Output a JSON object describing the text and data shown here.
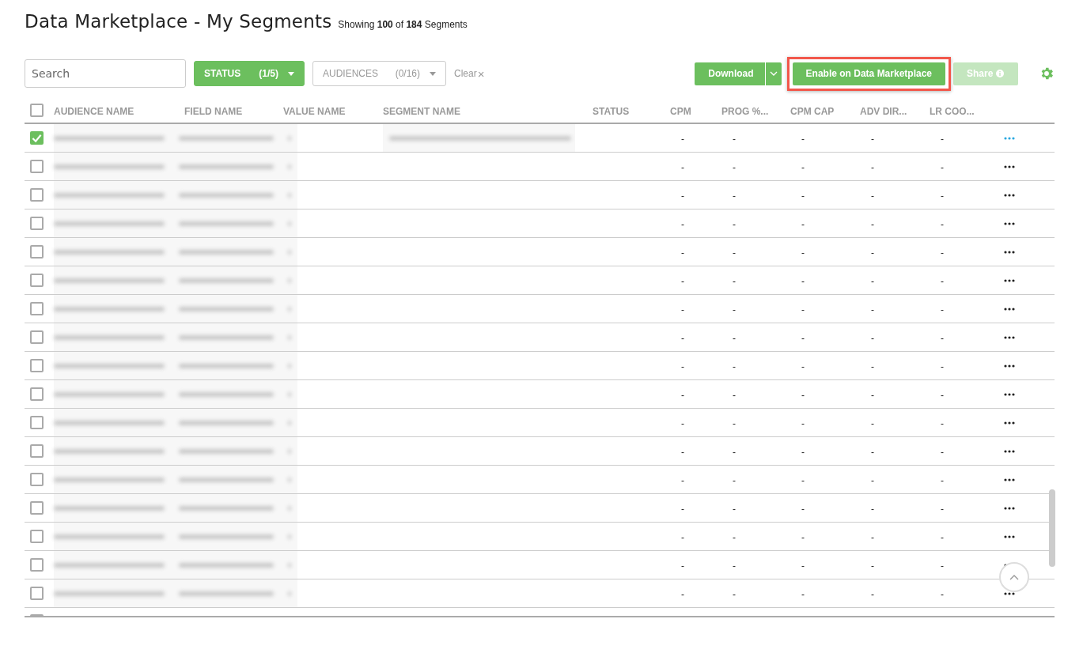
{
  "header": {
    "title": "Data Marketplace - My Segments",
    "summary": "Showing **100** of **184** Segments"
  },
  "toolbar": {
    "search": {
      "placeholder": "Search"
    },
    "filters": [
      {
        "label": "STATUS",
        "count": "(1/5)",
        "active": true
      },
      {
        "label": "AUDIENCES",
        "count": "(0/16)",
        "active": false
      }
    ],
    "clear": "Clear",
    "clear_icon": "×",
    "buttons": [
      {
        "kind": "split",
        "label": "Download",
        "disabled": false,
        "highlighted": false
      },
      {
        "kind": "plain",
        "label": "Enable on Data Marketplace",
        "disabled": false,
        "highlighted": true
      },
      {
        "kind": "info",
        "label": "Share",
        "disabled": true,
        "highlighted": false
      }
    ]
  },
  "table": {
    "all_checked": false,
    "columns": [
      "AUDIENCE NAME",
      "FIELD NAME",
      "VALUE NAME",
      "SEGMENT NAME",
      "STATUS",
      "CPM",
      "PROG %...",
      "CPM CAP",
      "ADV DIR...",
      "LR COO..."
    ],
    "rows": [
      {
        "checked": true,
        "cells": [
          "-",
          "-",
          "-",
          "-",
          "-"
        ]
      },
      {
        "checked": false,
        "cells": [
          "-",
          "-",
          "-",
          "-",
          "-"
        ]
      },
      {
        "checked": false,
        "cells": [
          "-",
          "-",
          "-",
          "-",
          "-"
        ]
      },
      {
        "checked": false,
        "cells": [
          "-",
          "-",
          "-",
          "-",
          "-"
        ]
      },
      {
        "checked": false,
        "cells": [
          "-",
          "-",
          "-",
          "-",
          "-"
        ]
      },
      {
        "checked": false,
        "cells": [
          "-",
          "-",
          "-",
          "-",
          "-"
        ]
      },
      {
        "checked": false,
        "cells": [
          "-",
          "-",
          "-",
          "-",
          "-"
        ]
      },
      {
        "checked": false,
        "cells": [
          "-",
          "-",
          "-",
          "-",
          "-"
        ]
      },
      {
        "checked": false,
        "cells": [
          "-",
          "-",
          "-",
          "-",
          "-"
        ]
      },
      {
        "checked": false,
        "cells": [
          "-",
          "-",
          "-",
          "-",
          "-"
        ]
      },
      {
        "checked": false,
        "cells": [
          "-",
          "-",
          "-",
          "-",
          "-"
        ]
      },
      {
        "checked": false,
        "cells": [
          "-",
          "-",
          "-",
          "-",
          "-"
        ]
      },
      {
        "checked": false,
        "cells": [
          "-",
          "-",
          "-",
          "-",
          "-"
        ]
      },
      {
        "checked": false,
        "cells": [
          "-",
          "-",
          "-",
          "-",
          "-"
        ]
      },
      {
        "checked": false,
        "cells": [
          "-",
          "-",
          "-",
          "-",
          "-"
        ]
      },
      {
        "checked": false,
        "cells": [
          "-",
          "-",
          "-",
          "-",
          "-"
        ]
      },
      {
        "checked": false,
        "cells": [
          "-",
          "-",
          "-",
          "-",
          "-"
        ]
      }
    ],
    "partial_row": {
      "checked": false
    }
  }
}
